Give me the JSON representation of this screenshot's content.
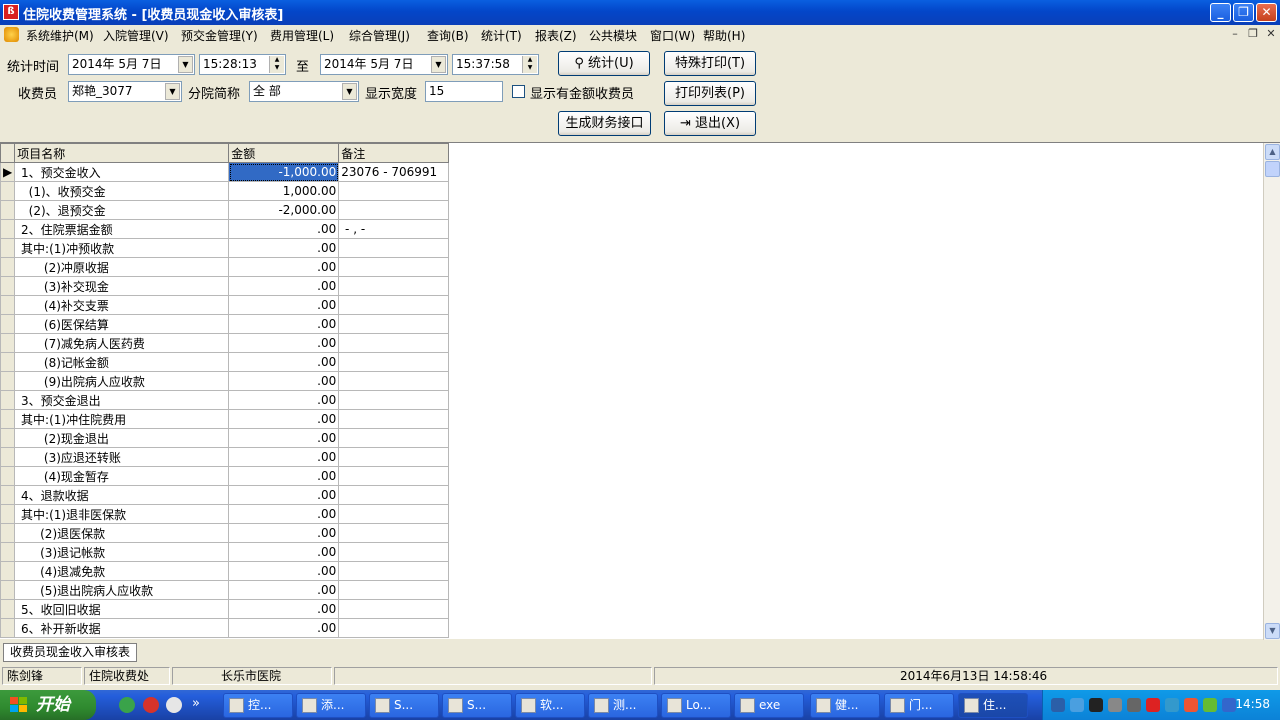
{
  "window": {
    "title": "住院收费管理系统 - [收费员现金收入审核表]",
    "icon_text": "ß"
  },
  "menu": [
    "系统维护(M)",
    "入院管理(V)",
    "预交金管理(Y)",
    "费用管理(L)",
    "综合管理(J)",
    "查询(B)",
    "统计(T)",
    "报表(Z)",
    "公共模块",
    "窗口(W)",
    "帮助(H)"
  ],
  "form": {
    "stat_time_label": "统计时间",
    "start_date": "2014年 5月 7日",
    "start_time": "15:28:13",
    "to_label": "至",
    "end_date": "2014年 5月 7日",
    "end_time": "15:37:58",
    "cashier_label": "收费员",
    "cashier_value": "郑艳_3077",
    "branch_label": "分院简称",
    "branch_value": "全 部",
    "width_label": "显示宽度",
    "width_value": "15",
    "show_nonzero_label": "显示有金额收费员",
    "buttons": {
      "stat": "统计(U)",
      "special_print": "特殊打印(T)",
      "print_list": "打印列表(P)",
      "gen_finance": "生成财务接口",
      "exit": "退出(X)"
    }
  },
  "table": {
    "headers": [
      "项目名称",
      "金额",
      "备注"
    ],
    "rows": [
      {
        "name": " 1、预交金收入",
        "amount": "-1,000.00",
        "note": "23076 - 706991"
      },
      {
        "name": "   (1)、收预交金",
        "amount": "1,000.00",
        "note": ""
      },
      {
        "name": "   (2)、退预交金",
        "amount": "-2,000.00",
        "note": ""
      },
      {
        "name": " 2、住院票据金额",
        "amount": ".00",
        "note": " - , -"
      },
      {
        "name": " 其中:(1)冲预收款",
        "amount": ".00",
        "note": ""
      },
      {
        "name": "       (2)冲原收据",
        "amount": ".00",
        "note": ""
      },
      {
        "name": "       (3)补交现金",
        "amount": ".00",
        "note": ""
      },
      {
        "name": "       (4)补交支票",
        "amount": ".00",
        "note": ""
      },
      {
        "name": "       (6)医保结算",
        "amount": ".00",
        "note": ""
      },
      {
        "name": "       (7)减免病人医药费",
        "amount": ".00",
        "note": ""
      },
      {
        "name": "       (8)记帐金额",
        "amount": ".00",
        "note": ""
      },
      {
        "name": "       (9)出院病人应收款",
        "amount": ".00",
        "note": ""
      },
      {
        "name": " 3、预交金退出",
        "amount": ".00",
        "note": ""
      },
      {
        "name": " 其中:(1)冲住院费用",
        "amount": ".00",
        "note": ""
      },
      {
        "name": "       (2)现金退出",
        "amount": ".00",
        "note": ""
      },
      {
        "name": "       (3)应退还转账",
        "amount": ".00",
        "note": ""
      },
      {
        "name": "       (4)现金暂存",
        "amount": ".00",
        "note": ""
      },
      {
        "name": " 4、退款收据",
        "amount": ".00",
        "note": ""
      },
      {
        "name": " 其中:(1)退非医保款",
        "amount": ".00",
        "note": ""
      },
      {
        "name": "      (2)退医保款",
        "amount": ".00",
        "note": ""
      },
      {
        "name": "      (3)退记帐款",
        "amount": ".00",
        "note": ""
      },
      {
        "name": "      (4)退减免款",
        "amount": ".00",
        "note": ""
      },
      {
        "name": "      (5)退出院病人应收款",
        "amount": ".00",
        "note": ""
      },
      {
        "name": " 5、收回旧收据",
        "amount": ".00",
        "note": ""
      },
      {
        "name": " 6、补开新收据",
        "amount": ".00",
        "note": ""
      }
    ]
  },
  "bottom_tab": "收费员现金收入审核表",
  "status": {
    "user": "陈剑锋",
    "dept": "住院收费处",
    "hospital": "长乐市医院",
    "datetime": "2014年6月13日  14:58:46"
  },
  "taskbar": {
    "start_label": "开始",
    "quicklaunch_more": "»",
    "tasks": [
      "控...",
      "添...",
      "S...",
      "S...",
      "软...",
      "测...",
      "Lo...",
      "exe",
      "健...",
      "门...",
      "住..."
    ],
    "clock": "14:58"
  },
  "colors": {
    "title_blue": "#0346c9",
    "selection": "#316ac5",
    "taskbar": "#245edb",
    "start_green": "#2f8a2f"
  }
}
